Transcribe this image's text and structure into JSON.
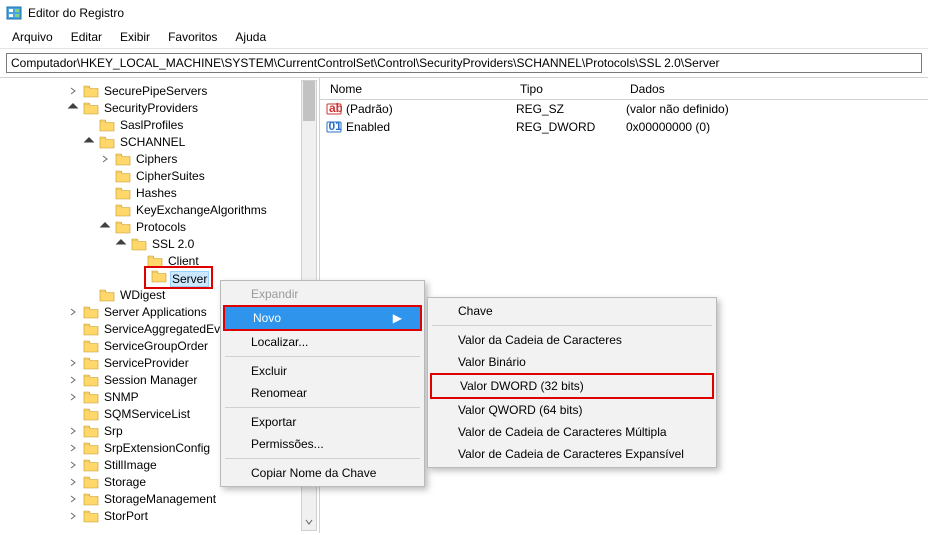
{
  "window": {
    "title": "Editor do Registro"
  },
  "menu": {
    "items": [
      "Arquivo",
      "Editar",
      "Exibir",
      "Favoritos",
      "Ajuda"
    ]
  },
  "address": {
    "path": "Computador\\HKEY_LOCAL_MACHINE\\SYSTEM\\CurrentControlSet\\Control\\SecurityProviders\\SCHANNEL\\Protocols\\SSL 2.0\\Server"
  },
  "tree": {
    "items": [
      {
        "label": "SecurePipeServers",
        "depth": 4,
        "twisty": "closed"
      },
      {
        "label": "SecurityProviders",
        "depth": 4,
        "twisty": "open"
      },
      {
        "label": "SaslProfiles",
        "depth": 5,
        "twisty": "none"
      },
      {
        "label": "SCHANNEL",
        "depth": 5,
        "twisty": "open"
      },
      {
        "label": "Ciphers",
        "depth": 6,
        "twisty": "closed"
      },
      {
        "label": "CipherSuites",
        "depth": 6,
        "twisty": "none"
      },
      {
        "label": "Hashes",
        "depth": 6,
        "twisty": "none"
      },
      {
        "label": "KeyExchangeAlgorithms",
        "depth": 6,
        "twisty": "none"
      },
      {
        "label": "Protocols",
        "depth": 6,
        "twisty": "open"
      },
      {
        "label": "SSL 2.0",
        "depth": 7,
        "twisty": "open"
      },
      {
        "label": "Client",
        "depth": 8,
        "twisty": "none"
      },
      {
        "label": "Server",
        "depth": 8,
        "twisty": "none",
        "selected": true,
        "boxed": true
      },
      {
        "label": "WDigest",
        "depth": 5,
        "twisty": "none"
      },
      {
        "label": "Server Applications",
        "depth": 4,
        "twisty": "closed"
      },
      {
        "label": "ServiceAggregatedEvents",
        "depth": 4,
        "twisty": "none"
      },
      {
        "label": "ServiceGroupOrder",
        "depth": 4,
        "twisty": "none"
      },
      {
        "label": "ServiceProvider",
        "depth": 4,
        "twisty": "closed"
      },
      {
        "label": "Session Manager",
        "depth": 4,
        "twisty": "closed"
      },
      {
        "label": "SNMP",
        "depth": 4,
        "twisty": "closed"
      },
      {
        "label": "SQMServiceList",
        "depth": 4,
        "twisty": "none"
      },
      {
        "label": "Srp",
        "depth": 4,
        "twisty": "closed"
      },
      {
        "label": "SrpExtensionConfig",
        "depth": 4,
        "twisty": "closed"
      },
      {
        "label": "StillImage",
        "depth": 4,
        "twisty": "closed"
      },
      {
        "label": "Storage",
        "depth": 4,
        "twisty": "closed"
      },
      {
        "label": "StorageManagement",
        "depth": 4,
        "twisty": "closed"
      },
      {
        "label": "StorPort",
        "depth": 4,
        "twisty": "closed"
      }
    ]
  },
  "values": {
    "cols": {
      "name": "Nome",
      "type": "Tipo",
      "data": "Dados"
    },
    "rows": [
      {
        "icon": "ab",
        "name": "(Padrão)",
        "type": "REG_SZ",
        "data": "(valor não definido)"
      },
      {
        "icon": "bin",
        "name": "Enabled",
        "type": "REG_DWORD",
        "data": "0x00000000 (0)"
      }
    ]
  },
  "context": {
    "expand": "Expandir",
    "novo": "Novo",
    "localizar": "Localizar...",
    "excluir": "Excluir",
    "renomear": "Renomear",
    "exportar": "Exportar",
    "permissoes": "Permissões...",
    "copiar": "Copiar Nome da Chave"
  },
  "submenu": {
    "chave": "Chave",
    "cadeia": "Valor da Cadeia de Caracteres",
    "binario": "Valor Binário",
    "dword": "Valor DWORD (32 bits)",
    "qword": "Valor QWORD (64 bits)",
    "multipla": "Valor de Cadeia de Caracteres Múltipla",
    "expansivel": "Valor de Cadeia de Caracteres Expansível"
  }
}
